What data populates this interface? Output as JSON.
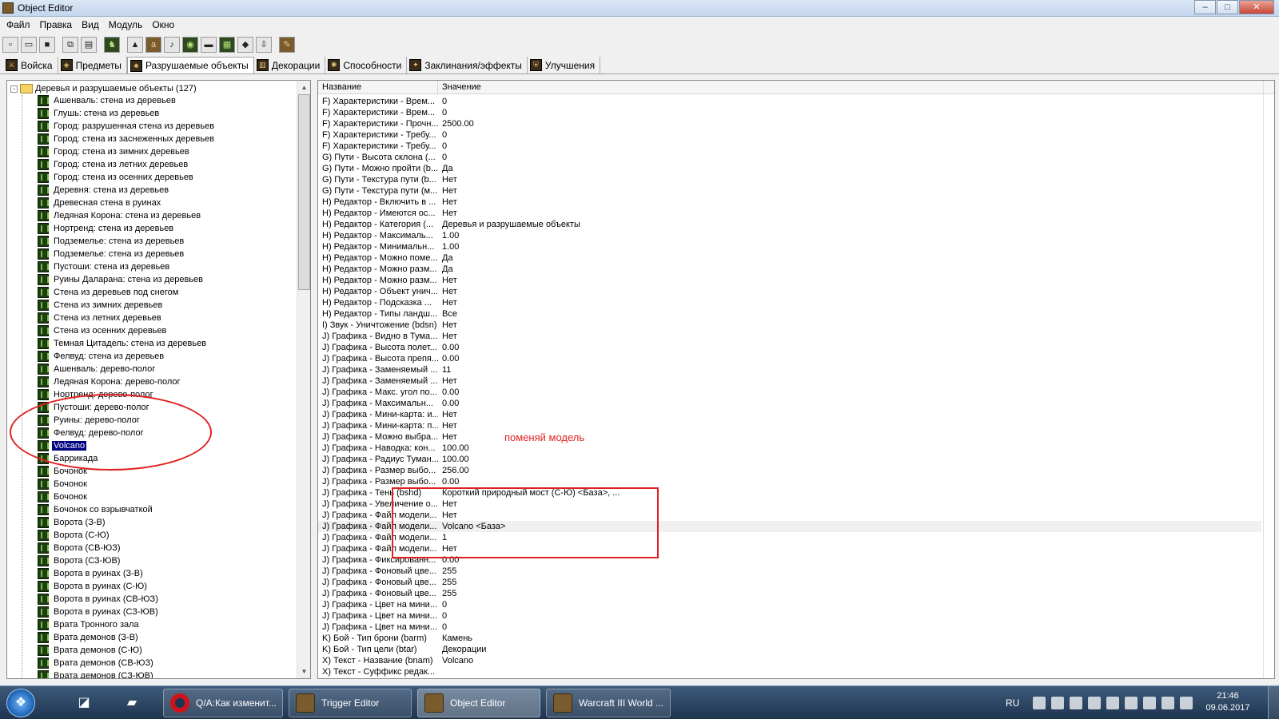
{
  "window": {
    "title": "Object Editor",
    "controls": {
      "minimize": "–",
      "maximize": "□",
      "close": "✕"
    }
  },
  "menu": [
    "Файл",
    "Правка",
    "Вид",
    "Модуль",
    "Окно"
  ],
  "toolbar_icons": [
    "new-icon",
    "open-icon",
    "save-icon",
    "copy-icon",
    "paste-icon",
    "units-icon",
    "terrain-icon",
    "gold-icon",
    "sound-icon",
    "object-icon",
    "region-icon",
    "map-icon",
    "doodad-icon",
    "import-icon",
    "script-icon"
  ],
  "tabs": [
    {
      "label": "Войска",
      "active": false
    },
    {
      "label": "Предметы",
      "active": false
    },
    {
      "label": "Разрушаемые объекты",
      "active": true
    },
    {
      "label": "Декорации",
      "active": false
    },
    {
      "label": "Способности",
      "active": false
    },
    {
      "label": "Заклинания/эффекты",
      "active": false
    },
    {
      "label": "Улучшения",
      "active": false
    }
  ],
  "tree": {
    "root_label": "Деревья и разрушаемые объекты (127)",
    "expander": "-",
    "items": [
      "Ашенваль: стена из деревьев",
      "Глушь: стена из деревьев",
      "Город: разрушенная стена из деревьев",
      "Город: стена из заснеженных деревьев",
      "Город: стена из зимних деревьев",
      "Город: стена из летних деревьев",
      "Город: стена из осенних деревьев",
      "Деревня: стена из деревьев",
      "Древесная стена в руинах",
      "Ледяная Корона: стена из деревьев",
      "Нортренд: стена из деревьев",
      "Подземелье: стена из деревьев",
      "Подземелье: стена из деревьев",
      "Пустоши: стена из деревьев",
      "Руины Даларана: стена из деревьев",
      "Стена из деревьев под снегом",
      "Стена из зимних деревьев",
      "Стена из летних деревьев",
      "Стена из осенних деревьев",
      "Темная Цитадель: стена из деревьев",
      "Фелвуд: стена из деревьев",
      "Ашенваль: дерево-полог",
      "Ледяная Корона: дерево-полог",
      "Нортренд: дерево-полог",
      "Пустоши: дерево-полог",
      "Руины: дерево-полог",
      "Фелвуд: дерево-полог",
      "Volcano",
      "Баррикада",
      "Бочонок",
      "Бочонок",
      "Бочонок",
      "Бочонок со взрывчаткой",
      "Ворота (З-В)",
      "Ворота (С-Ю)",
      "Ворота (СВ-ЮЗ)",
      "Ворота (СЗ-ЮВ)",
      "Ворота в руинах (З-В)",
      "Ворота в руинах (С-Ю)",
      "Ворота в руинах (СВ-ЮЗ)",
      "Ворота в руинах (СЗ-ЮВ)",
      "Врата Тронного зала",
      "Врата демонов (З-В)",
      "Врата демонов (С-Ю)",
      "Врата демонов (СВ-ЮЗ)",
      "Врата демонов (СЗ-ЮВ)"
    ],
    "selected_index": 27
  },
  "grid": {
    "columns": {
      "name": "Название",
      "value": "Значение"
    },
    "rows": [
      {
        "name": "F) Характеристики - Врем...",
        "value": "0"
      },
      {
        "name": "F) Характеристики - Врем...",
        "value": "0"
      },
      {
        "name": "F) Характеристики - Прочн...",
        "value": "2500.00"
      },
      {
        "name": "F) Характеристики - Требу...",
        "value": "0"
      },
      {
        "name": "F) Характеристики - Требу...",
        "value": "0"
      },
      {
        "name": "G) Пути - Высота склона (...",
        "value": "0"
      },
      {
        "name": "G) Пути - Можно пройти (b...",
        "value": "Да"
      },
      {
        "name": "G) Пути - Текстура пути (b...",
        "value": "Нет"
      },
      {
        "name": "G) Пути - Текстура пути (м...",
        "value": "Нет"
      },
      {
        "name": "H) Редактор - Включить в ...",
        "value": "Нет"
      },
      {
        "name": "H) Редактор - Имеются ос...",
        "value": "Нет"
      },
      {
        "name": "H) Редактор - Категория (...",
        "value": "Деревья и разрушаемые объекты"
      },
      {
        "name": "H) Редактор - Максималь...",
        "value": "1.00"
      },
      {
        "name": "H) Редактор - Минимальн...",
        "value": "1.00"
      },
      {
        "name": "H) Редактор - Можно поме...",
        "value": "Да"
      },
      {
        "name": "H) Редактор - Можно разм...",
        "value": "Да"
      },
      {
        "name": "H) Редактор - Можно разм...",
        "value": "Нет"
      },
      {
        "name": "H) Редактор - Объект унич...",
        "value": "Нет"
      },
      {
        "name": "H) Редактор - Подсказка ...",
        "value": "Нет"
      },
      {
        "name": "H) Редактор - Типы ландш...",
        "value": "Все"
      },
      {
        "name": "I) Звук - Уничтожение (bdsn)",
        "value": "Нет"
      },
      {
        "name": "J) Графика - Видно в Тума...",
        "value": "Нет"
      },
      {
        "name": "J) Графика - Высота полет...",
        "value": "0.00"
      },
      {
        "name": "J) Графика - Высота препя...",
        "value": "0.00"
      },
      {
        "name": "J) Графика - Заменяемый ...",
        "value": "11"
      },
      {
        "name": "J) Графика - Заменяемый ...",
        "value": "Нет"
      },
      {
        "name": "J) Графика - Макс. угол по...",
        "value": "0.00"
      },
      {
        "name": "J) Графика - Максимальн...",
        "value": "0.00"
      },
      {
        "name": "J) Графика - Мини-карта: и...",
        "value": "Нет"
      },
      {
        "name": "J) Графика - Мини-карта: п...",
        "value": "Нет"
      },
      {
        "name": "J) Графика - Можно выбра...",
        "value": "Нет"
      },
      {
        "name": "J) Графика - Наводка: кон...",
        "value": "100.00"
      },
      {
        "name": "J) Графика - Радиус Туман...",
        "value": "100.00"
      },
      {
        "name": "J) Графика - Размер выбо...",
        "value": "256.00"
      },
      {
        "name": "J) Графика - Размер выбо...",
        "value": "0.00"
      },
      {
        "name": "J) Графика - Тень (bshd)",
        "value": "Короткий природный мост (С-Ю) <База>, ..."
      },
      {
        "name": "J) Графика - Увеличение о...",
        "value": "Нет"
      },
      {
        "name": "J) Графика - Файл модели...",
        "value": "Нет"
      },
      {
        "name": "J) Графика - Файл модели...",
        "value": "Volcano <База>"
      },
      {
        "name": "J) Графика - Файл модели...",
        "value": "1"
      },
      {
        "name": "J) Графика - Файл модели...",
        "value": "Нет"
      },
      {
        "name": "J) Графика - Фиксированн...",
        "value": "0.00"
      },
      {
        "name": "J) Графика - Фоновый цве...",
        "value": "255"
      },
      {
        "name": "J) Графика - Фоновый цве...",
        "value": "255"
      },
      {
        "name": "J) Графика - Фоновый цве...",
        "value": "255"
      },
      {
        "name": "J) Графика - Цвет на мини...",
        "value": "0"
      },
      {
        "name": "J) Графика - Цвет на мини...",
        "value": "0"
      },
      {
        "name": "J) Графика - Цвет на мини...",
        "value": "0"
      },
      {
        "name": "K) Бой - Тип брони (barm)",
        "value": "Камень"
      },
      {
        "name": "K) Бой - Тип цели (btar)",
        "value": "Декорации"
      },
      {
        "name": "X) Текст - Название (bnam)",
        "value": "Volcano"
      },
      {
        "name": "X) Текст - Суффикс редак...",
        "value": ""
      }
    ],
    "highlighted_index": 38
  },
  "annotation": {
    "note": "поменяй модель",
    "color": "#e02020"
  },
  "taskbar": {
    "start_icon": "windows-logo-icon",
    "pinned": [
      "explorer-icon",
      "folder-icon"
    ],
    "buttons": [
      {
        "label": "Q/A:Как изменит...",
        "icon": "opera-icon",
        "active": false
      },
      {
        "label": "Trigger Editor",
        "icon": "warcraft-icon",
        "active": false
      },
      {
        "label": "Object Editor",
        "icon": "warcraft-icon",
        "active": true
      },
      {
        "label": "Warcraft III World ...",
        "icon": "warcraft-icon",
        "active": false
      }
    ],
    "language": "RU",
    "time": "21:46",
    "date": "09.06.2017"
  }
}
